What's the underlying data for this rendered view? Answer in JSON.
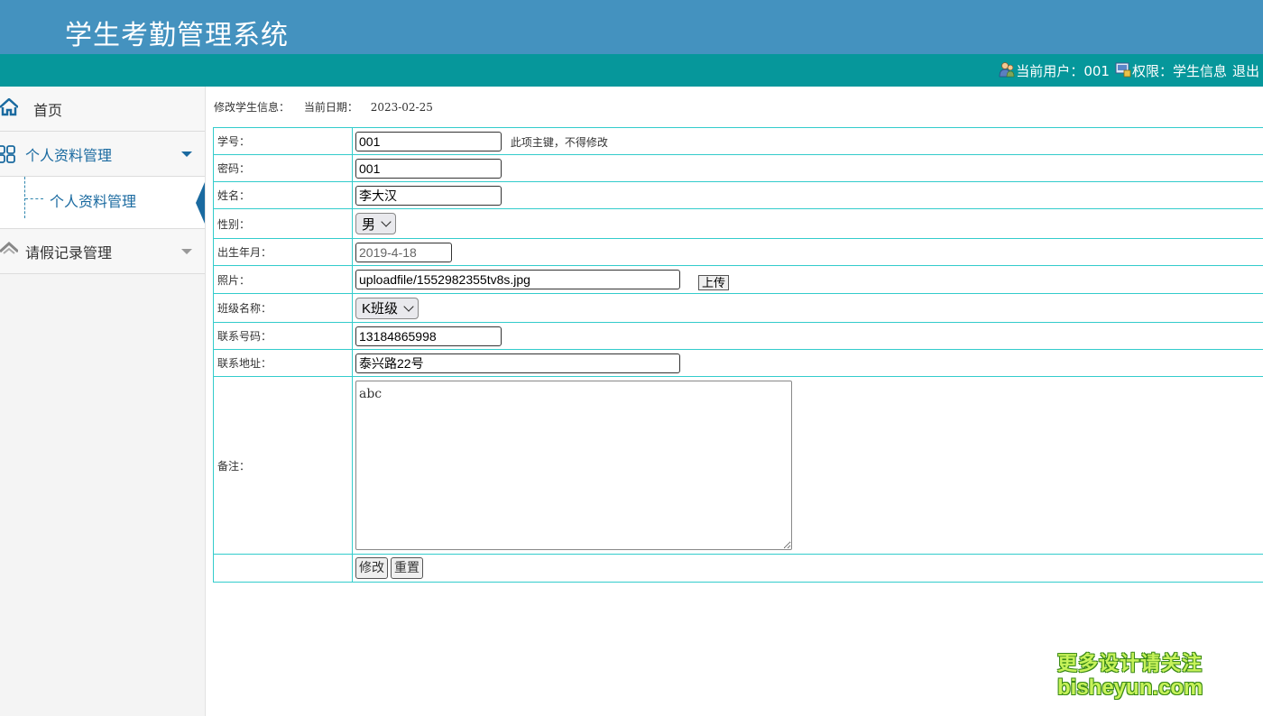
{
  "header": {
    "title": "学生考勤管理系统"
  },
  "userbar": {
    "user_label": "当前用户：",
    "user_value": "001",
    "perm_label": "权限：",
    "perm_value": "学生信息",
    "logout": "退出"
  },
  "sidebar": {
    "home": "首页",
    "profile_group": "个人资料管理",
    "profile_sub": "个人资料管理",
    "leave_group": "请假记录管理"
  },
  "breadcrumb": {
    "title": "修改学生信息：",
    "date_label": "当前日期：",
    "date_value": "2023-02-25"
  },
  "form": {
    "student_id": {
      "label": "学号：",
      "value": "001",
      "hint": "此项主键，不得修改"
    },
    "password": {
      "label": "密码：",
      "value": "001"
    },
    "name": {
      "label": "姓名：",
      "value": "李大汉"
    },
    "gender": {
      "label": "性别：",
      "value": "男"
    },
    "birthdate": {
      "label": "出生年月：",
      "value": "2019-4-18"
    },
    "photo": {
      "label": "照片：",
      "value": "uploadfile/1552982355tv8s.jpg",
      "upload": "上传"
    },
    "class_name": {
      "label": "班级名称：",
      "value": "K班级"
    },
    "phone": {
      "label": "联系号码：",
      "value": "13184865998"
    },
    "address": {
      "label": "联系地址：",
      "value": "泰兴路22号"
    },
    "memo": {
      "label": "备注：",
      "value": "abc"
    },
    "submit": "修改",
    "reset": "重置"
  },
  "watermark": {
    "line1": "更多设计请关注",
    "line2": "bisheyun.com"
  },
  "colors": {
    "header": "#4492bf",
    "userbar": "#06979b",
    "table_border": "#33cccc",
    "menu_active": "#1a6aa0"
  }
}
